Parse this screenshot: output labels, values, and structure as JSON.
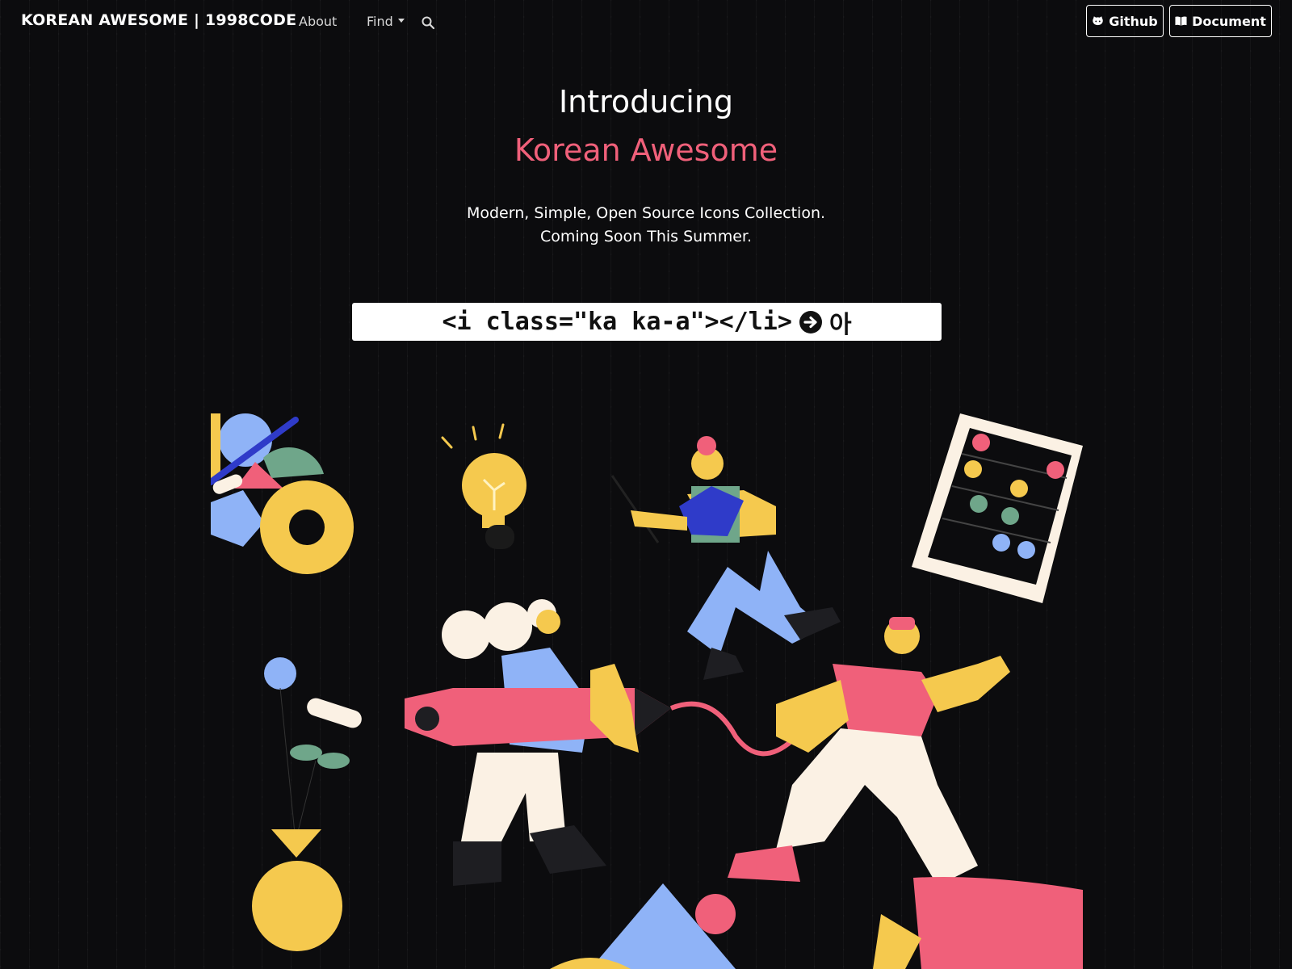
{
  "navbar": {
    "brand": "KOREAN AWESOME | 1998CODE",
    "about": "About",
    "find": "Find",
    "search_icon": "search-icon",
    "github_label": "Github",
    "document_label": "Document"
  },
  "hero": {
    "title": "Introducing",
    "subtitle": "Korean Awesome",
    "tagline_1": "Modern, Simple, Open Source Icons Collection.",
    "tagline_2": "Coming Soon This Summer."
  },
  "code_sample": {
    "code": "<i class=\"ka ka-a\"></li>",
    "arrow_icon": "arrow-circle-right-icon",
    "result": "아"
  },
  "colors": {
    "background": "#0c0c0e",
    "accent": "#f0607a",
    "yellow": "#f5c94e",
    "blue": "#8fb3f7",
    "cream": "#fbf1e4",
    "teal": "#6fa68a",
    "dark_blue": "#2f3bc9"
  }
}
